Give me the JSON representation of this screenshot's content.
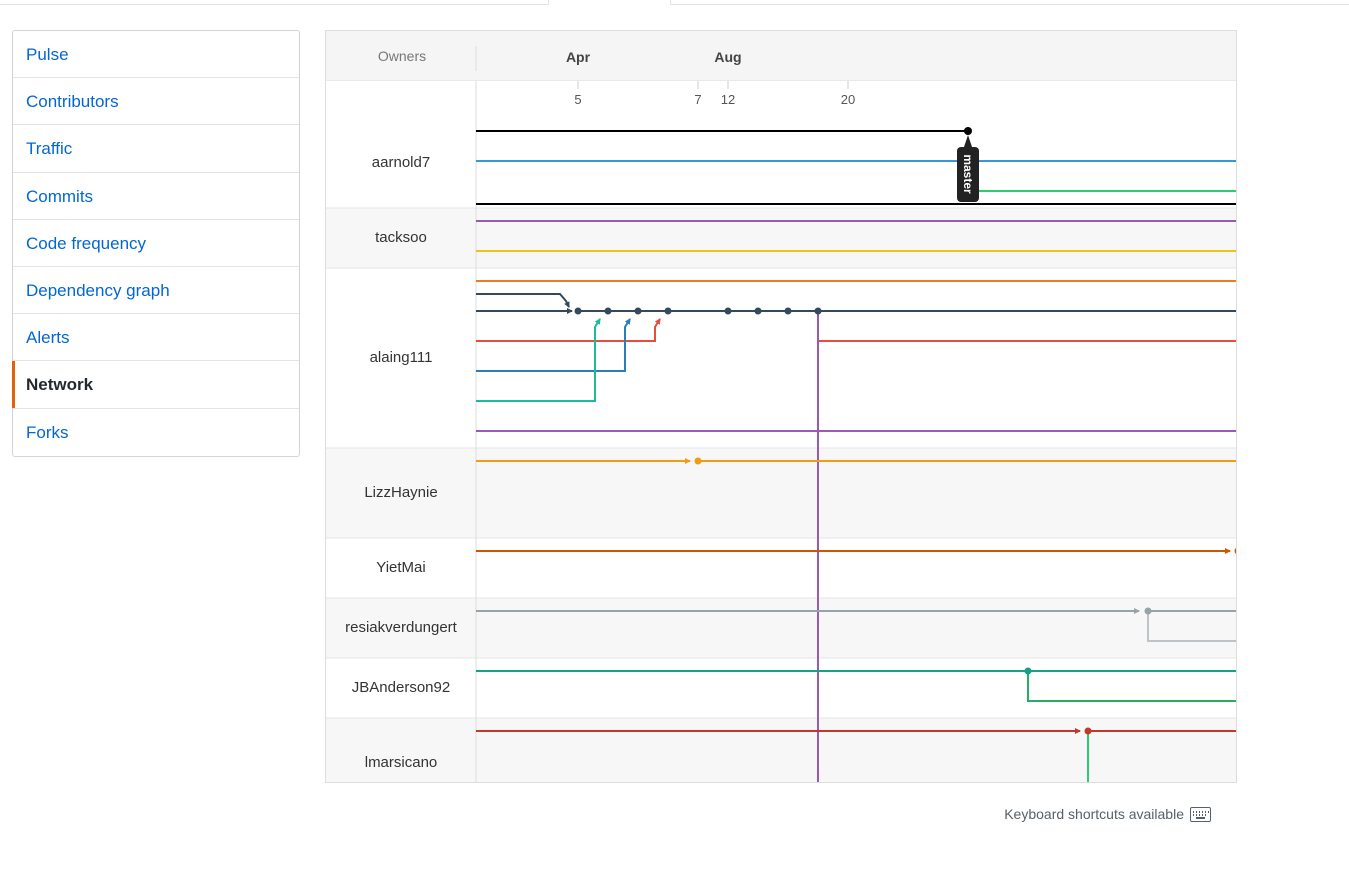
{
  "menu": {
    "items": [
      {
        "label": "Pulse",
        "selected": false
      },
      {
        "label": "Contributors",
        "selected": false
      },
      {
        "label": "Traffic",
        "selected": false
      },
      {
        "label": "Commits",
        "selected": false
      },
      {
        "label": "Code frequency",
        "selected": false
      },
      {
        "label": "Dependency graph",
        "selected": false
      },
      {
        "label": "Alerts",
        "selected": false
      },
      {
        "label": "Network",
        "selected": true
      },
      {
        "label": "Forks",
        "selected": false
      }
    ]
  },
  "network": {
    "owners_header": "Owners",
    "months": [
      "Apr",
      "Aug"
    ],
    "days": [
      "5",
      "7",
      "12",
      "20"
    ],
    "branch_label": "master",
    "owners": [
      "aarnold7",
      "tacksoo",
      "alaing111",
      "LizzHaynie",
      "YietMai",
      "resiakverdungert",
      "JBAnderson92",
      "lmarsicano"
    ],
    "colors": {
      "black": "#000000",
      "blue": "#3498db",
      "green": "#2ecc71",
      "purple": "#8e44ad",
      "purple2": "#9b59b6",
      "yellow": "#f1c40f",
      "orange": "#e67e22",
      "navy": "#34495e",
      "red": "#e74c3c",
      "steel": "#2980b9",
      "teal": "#1abc9c",
      "amber": "#f39c12",
      "burnt": "#d35400",
      "gray": "#95a5a6",
      "lightgray": "#bdc3c7",
      "emerald": "#27ae60",
      "darkgreen": "#16a085",
      "crimson": "#c0392b"
    }
  },
  "footer": {
    "keyboard_shortcuts": "Keyboard shortcuts available"
  }
}
